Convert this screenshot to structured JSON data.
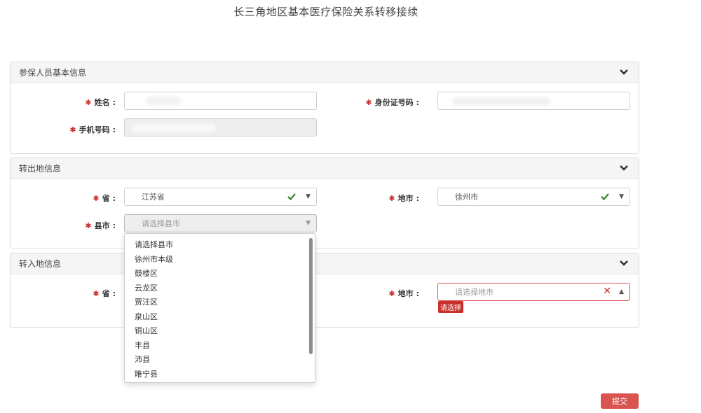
{
  "page": {
    "title": "长三角地区基本医疗保险关系转移接续"
  },
  "section_basic": {
    "title": "参保人员基本信息",
    "name_label": "姓名",
    "id_label": "身份证号码",
    "phone_label": "手机号码"
  },
  "section_out": {
    "title": "转出地信息",
    "province_label": "省",
    "province_value": "江苏省",
    "city_label": "地市",
    "city_value": "徐州市",
    "county_label": "县市",
    "county_placeholder": "请选择县市"
  },
  "section_in": {
    "title": "转入地信息",
    "province_label": "省",
    "city_label": "地市",
    "city_placeholder": "请选择地市",
    "city_error": "请选择"
  },
  "dropdown": {
    "options": [
      "请选择县市",
      "徐州市本级",
      "鼓楼区",
      "云龙区",
      "贾汪区",
      "泉山区",
      "铜山区",
      "丰县",
      "沛县",
      "睢宁县"
    ]
  },
  "actions": {
    "submit_label": "提交"
  },
  "symbols": {
    "required": "✱",
    "colon": ":"
  },
  "colors": {
    "required": "#c9302c",
    "check": "#3c8d2f",
    "error": "#d9534f"
  }
}
